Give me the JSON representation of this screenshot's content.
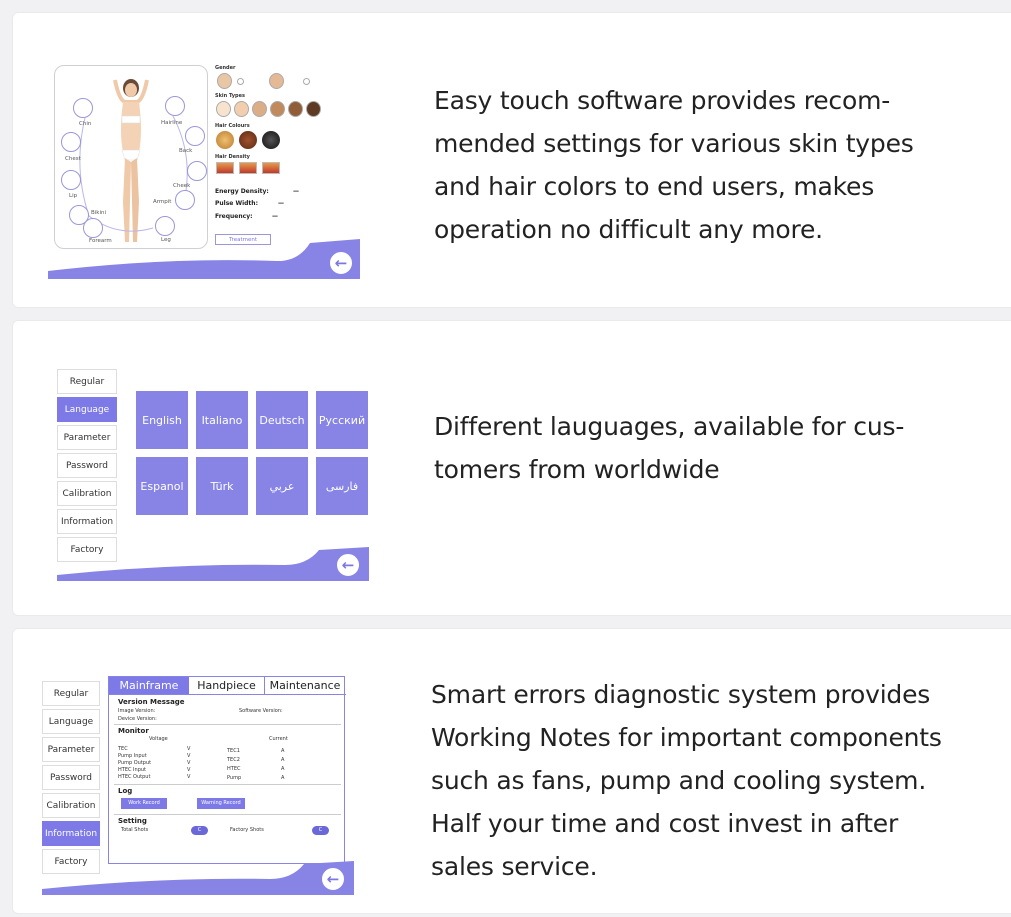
{
  "cards": [
    {
      "description": "Easy touch software provides recom-\nmended settings for various skin types\nand hair colors to end users, makes\noperation no difficult any more.",
      "screen": {
        "zones": [
          "Chin",
          "Hairline",
          "Back",
          "Chest",
          "Cheek",
          "Lip",
          "Armpit",
          "Bikini",
          "Leg",
          "Forearm"
        ],
        "gender_label": "Gender",
        "skin_types_label": "Skin Types",
        "hair_colour_label": "Hair Colours",
        "hair_density_label": "Hair Density",
        "energy_density_label": "Energy Density:",
        "pulse_width_label": "Pulse Width:",
        "frequency_label": "Frequency:",
        "empty_value": "—",
        "treatment_button": "Treatment"
      }
    },
    {
      "description": "Different lauguages, available for cus-\ntomers from worldwide",
      "screen": {
        "menu": [
          "Regular",
          "Language",
          "Parameter",
          "Password",
          "Calibration",
          "Information",
          "Factory"
        ],
        "active_menu": "Language",
        "languages": [
          "English",
          "Italiano",
          "Deutsch",
          "Русский",
          "Espanol",
          "Türk",
          "عربي",
          "فارسی"
        ]
      }
    },
    {
      "description": "Smart errors diagnostic system provides\nWorking Notes for important components\nsuch as fans, pump and cooling system.\nHalf your time and cost invest in after\nsales service.",
      "screen": {
        "menu": [
          "Regular",
          "Language",
          "Parameter",
          "Password",
          "Calibration",
          "Information",
          "Factory"
        ],
        "active_menu": "Information",
        "tabs": [
          "Mainframe",
          "Handpiece",
          "Maintenance"
        ],
        "version_message": "Version Message",
        "image_version": "Image Version:",
        "software_version": "Software Version:",
        "device_version": "Device Version:",
        "monitor": "Monitor",
        "voltage": "Voltage",
        "current": "Current",
        "voltage_rows": [
          "TEC",
          "Pump Input",
          "Pump Output",
          "HTEC Input",
          "HTEC Output"
        ],
        "current_rows": [
          "TEC1",
          "TEC2",
          "HTEC",
          "Pump"
        ],
        "volt_unit": "V",
        "amp_unit": "A",
        "log": "Log",
        "work_record": "Work Record",
        "warning_record": "Warning Record",
        "setting": "Setting",
        "total_shots": "Total Shots",
        "factory_shots": "Factory Shots",
        "clear_btn": "C"
      }
    }
  ],
  "colors": {
    "accent": "#7d7ae8",
    "wave": "#8784e6"
  }
}
